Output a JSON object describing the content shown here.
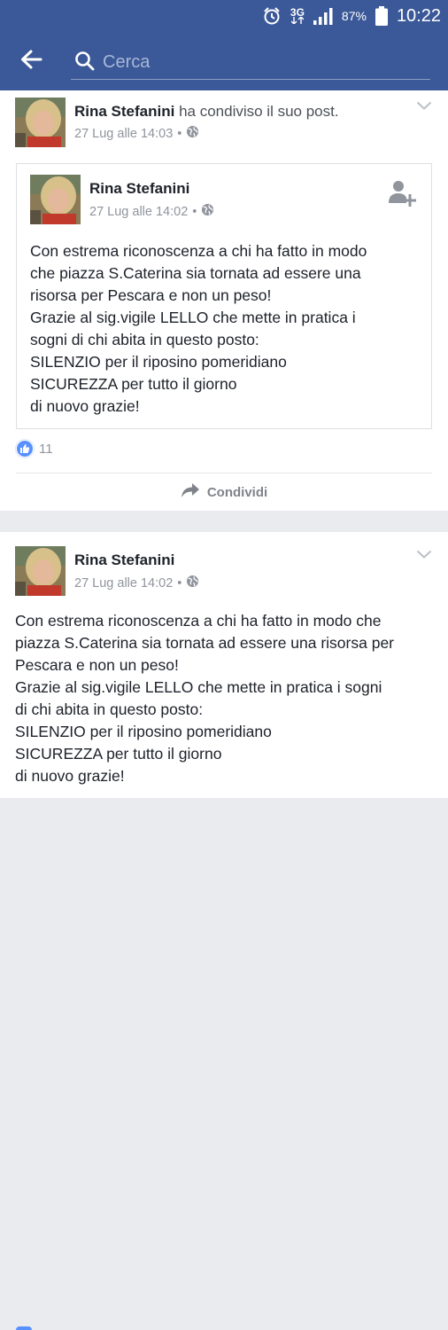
{
  "status_bar": {
    "network": "3G",
    "battery": "87%",
    "time": "10:22"
  },
  "app_bar": {
    "search_placeholder": "Cerca"
  },
  "post1": {
    "author": "Rina Stefanini",
    "action": " ha condiviso il suo post.",
    "timestamp": "27 Lug alle 14:03",
    "separator": "•",
    "shared": {
      "author": "Rina Stefanini",
      "timestamp": "27 Lug alle 14:02",
      "separator": "•",
      "text": "Con estrema riconoscenza a chi ha fatto in modo\nche piazza S.Caterina sia tornata ad essere una\nrisorsa per Pescara e non un peso!\nGrazie al sig.vigile LELLO che mette in pratica i\nsogni di chi abita in questo posto:\nSILENZIO  per il riposino pomeridiano\nSICUREZZA per tutto il giorno\ndi nuovo grazie!"
    },
    "likes": "11",
    "share_label": "Condividi"
  },
  "post2": {
    "author": "Rina Stefanini",
    "timestamp": "27 Lug alle 14:02",
    "separator": "•",
    "text": "Con estrema riconoscenza a chi ha fatto in modo che\npiazza S.Caterina sia tornata ad essere una risorsa per\nPescara e non un peso!\nGrazie al sig.vigile LELLO che mette in pratica i sogni\ndi chi abita in questo posto:\nSILENZIO  per il riposino pomeridiano\nSICUREZZA per tutto il giorno\ndi nuovo grazie!"
  },
  "colors": {
    "brand": "#3b5998",
    "like": "#5890ff",
    "meta_text": "#90949c"
  },
  "icons": {
    "back": "arrow-left-icon",
    "search": "search-icon",
    "privacy": "globe-icon",
    "menu": "chevron-down-icon",
    "add_friend": "add-friend-icon",
    "like": "thumbs-up-icon",
    "share": "share-arrow-icon"
  }
}
